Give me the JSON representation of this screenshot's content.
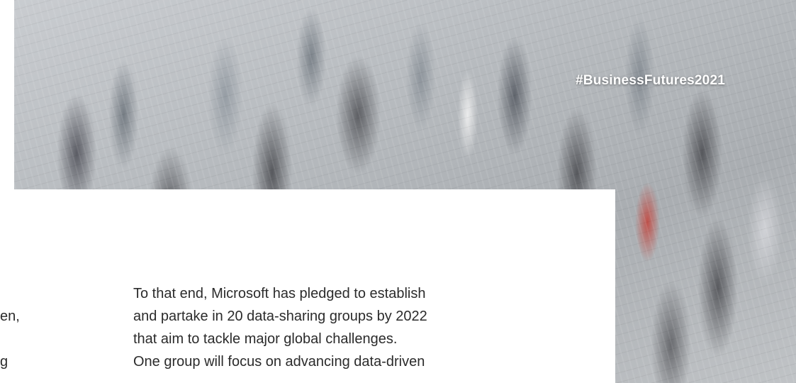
{
  "hero": {
    "hashtag": "#BusinessFutures2021",
    "image_icon": "crowd-photo"
  },
  "left_column": {
    "fragments": [
      "en,",
      "g"
    ]
  },
  "article": {
    "lines": [
      "To that end, Microsoft has pledged to establish",
      "and partake in 20 data-sharing groups by 2022",
      "that aim to tackle major global challenges.",
      "One group will focus on advancing data-driven"
    ]
  },
  "colors": {
    "text": "#2b2b2b",
    "background": "#ffffff",
    "hashtag": "#ffffff"
  }
}
